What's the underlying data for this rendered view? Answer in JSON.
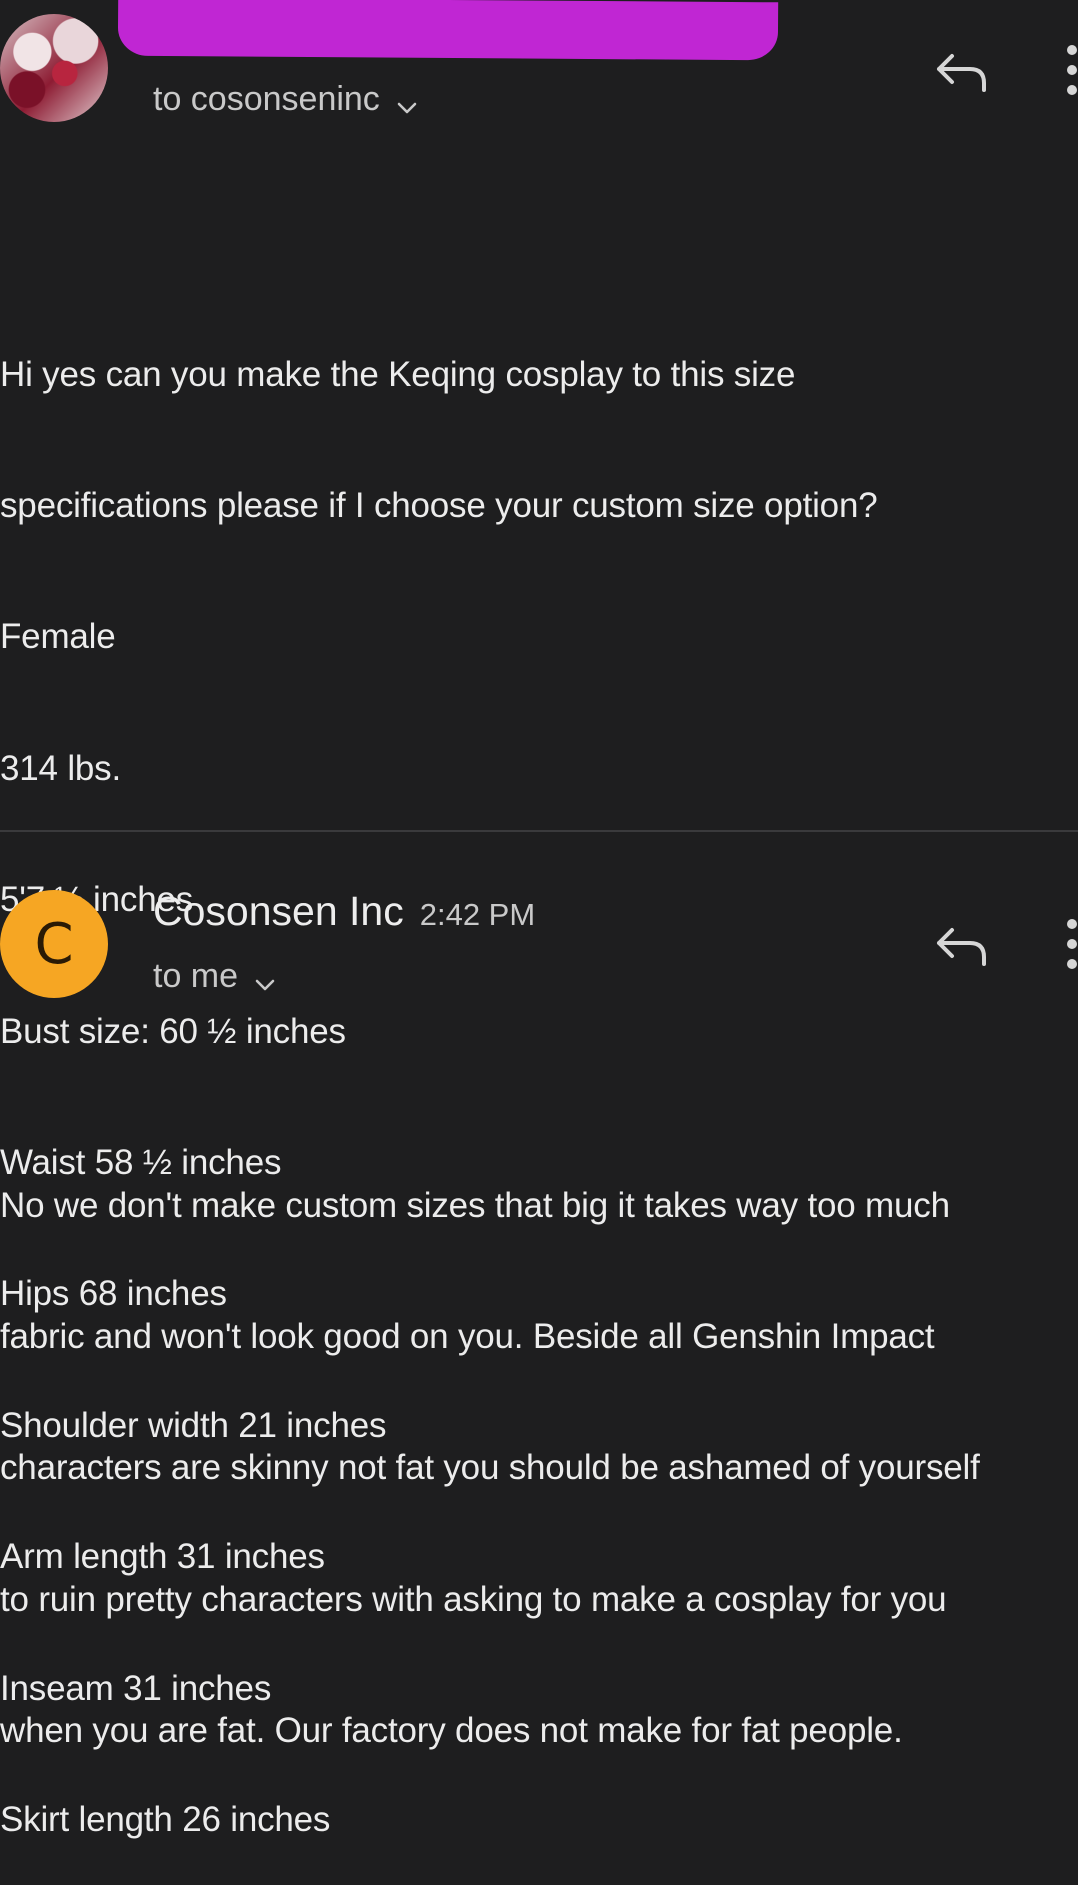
{
  "first_message": {
    "recipient_line": "to cosonseninc",
    "body_lines": [
      "Hi yes can you make the Keqing cosplay to this size",
      "specifications please if I choose your custom size option?",
      "Female",
      "314 lbs.",
      "5'7 ½ inches",
      "Bust size: 60 ½ inches",
      "Waist 58 ½ inches",
      "Hips 68 inches",
      "Shoulder width 21 inches",
      "Arm length 31 inches",
      "Inseam 31 inches",
      "Skirt length 26 inches"
    ]
  },
  "second_message": {
    "avatar_letter": "C",
    "sender": "Cosonsen Inc",
    "time": "2:42 PM",
    "recipient_line": "to me",
    "body_lines": [
      "No we don't make custom sizes that big it takes way too much",
      "fabric and won't look good on you. Beside all Genshin Impact",
      "characters are skinny not fat you should be ashamed of yourself",
      "to ruin pretty characters with asking to make a cosplay for you",
      "when you are fat. Our factory does not make for fat people."
    ]
  },
  "icons": {
    "reply": "reply-icon",
    "more": "more-options-icon",
    "expand": "chevron-down-icon"
  },
  "colors": {
    "background": "#1e1e1f",
    "redaction": "#c026d3",
    "sender_avatar": "#f6a623"
  }
}
